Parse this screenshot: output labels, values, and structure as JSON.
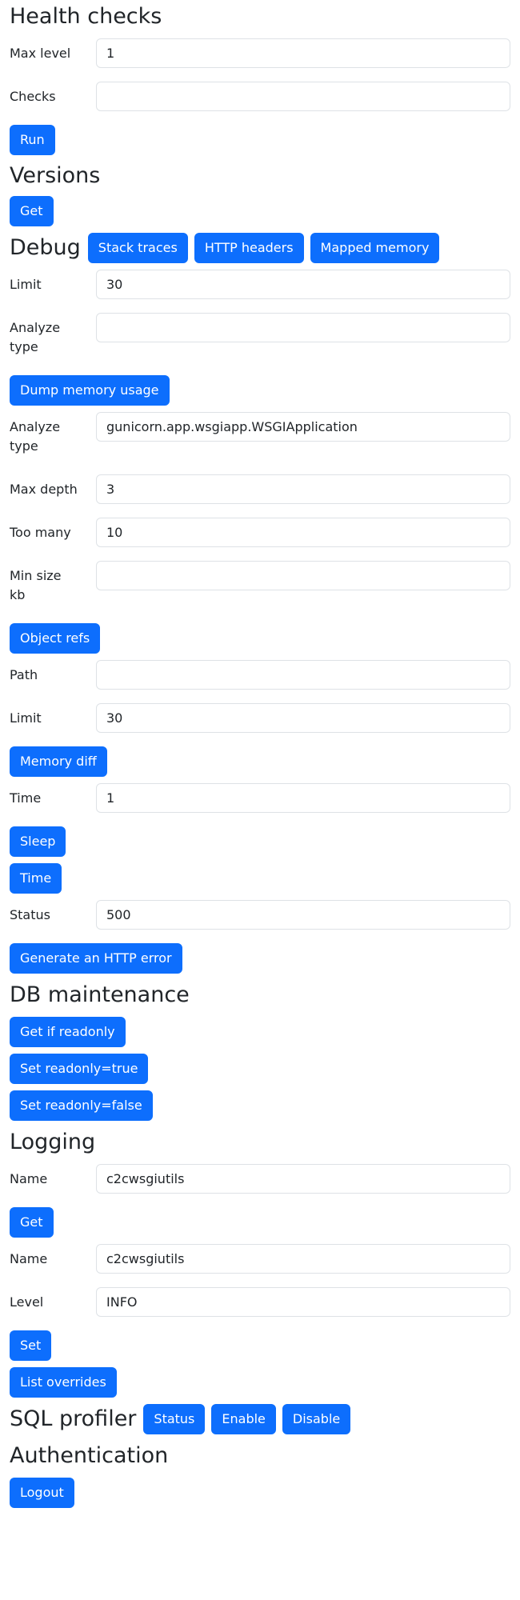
{
  "health_checks": {
    "title": "Health checks",
    "max_level": {
      "label": "Max level",
      "value": "1"
    },
    "checks": {
      "label": "Checks",
      "value": ""
    },
    "run_label": "Run"
  },
  "versions": {
    "title": "Versions",
    "get_label": "Get"
  },
  "debug": {
    "title": "Debug",
    "stack_traces_label": "Stack traces",
    "http_headers_label": "HTTP headers",
    "mapped_memory_label": "Mapped memory",
    "dump_memory": {
      "limit": {
        "label": "Limit",
        "value": "30"
      },
      "analyze_type": {
        "label": "Analyze type",
        "value": ""
      },
      "button_label": "Dump memory usage"
    },
    "object_refs": {
      "analyze_type": {
        "label": "Analyze type",
        "value": "gunicorn.app.wsgiapp.WSGIApplication"
      },
      "max_depth": {
        "label": "Max depth",
        "value": "3"
      },
      "too_many": {
        "label": "Too many",
        "value": "10"
      },
      "min_size_kb": {
        "label": "Min size kb",
        "value": ""
      },
      "button_label": "Object refs"
    },
    "memory_diff": {
      "path": {
        "label": "Path",
        "value": ""
      },
      "limit": {
        "label": "Limit",
        "value": "30"
      },
      "button_label": "Memory diff"
    },
    "sleep": {
      "time": {
        "label": "Time",
        "value": "1"
      },
      "button_label": "Sleep"
    },
    "time_label": "Time",
    "http_error": {
      "status": {
        "label": "Status",
        "value": "500"
      },
      "button_label": "Generate an HTTP error"
    }
  },
  "db_maintenance": {
    "title": "DB maintenance",
    "get_readonly_label": "Get if readonly",
    "set_true_label": "Set readonly=true",
    "set_false_label": "Set readonly=false"
  },
  "logging": {
    "title": "Logging",
    "get": {
      "name": {
        "label": "Name",
        "value": "c2cwsgiutils"
      },
      "button_label": "Get"
    },
    "set": {
      "name": {
        "label": "Name",
        "value": "c2cwsgiutils"
      },
      "level": {
        "label": "Level",
        "value": "INFO"
      },
      "button_label": "Set"
    },
    "list_overrides_label": "List overrides"
  },
  "sql_profiler": {
    "title": "SQL profiler",
    "status_label": "Status",
    "enable_label": "Enable",
    "disable_label": "Disable"
  },
  "authentication": {
    "title": "Authentication",
    "logout_label": "Logout"
  },
  "colors": {
    "primary": "#0d6efd",
    "text": "#212529",
    "input_border": "#dee2e6"
  }
}
